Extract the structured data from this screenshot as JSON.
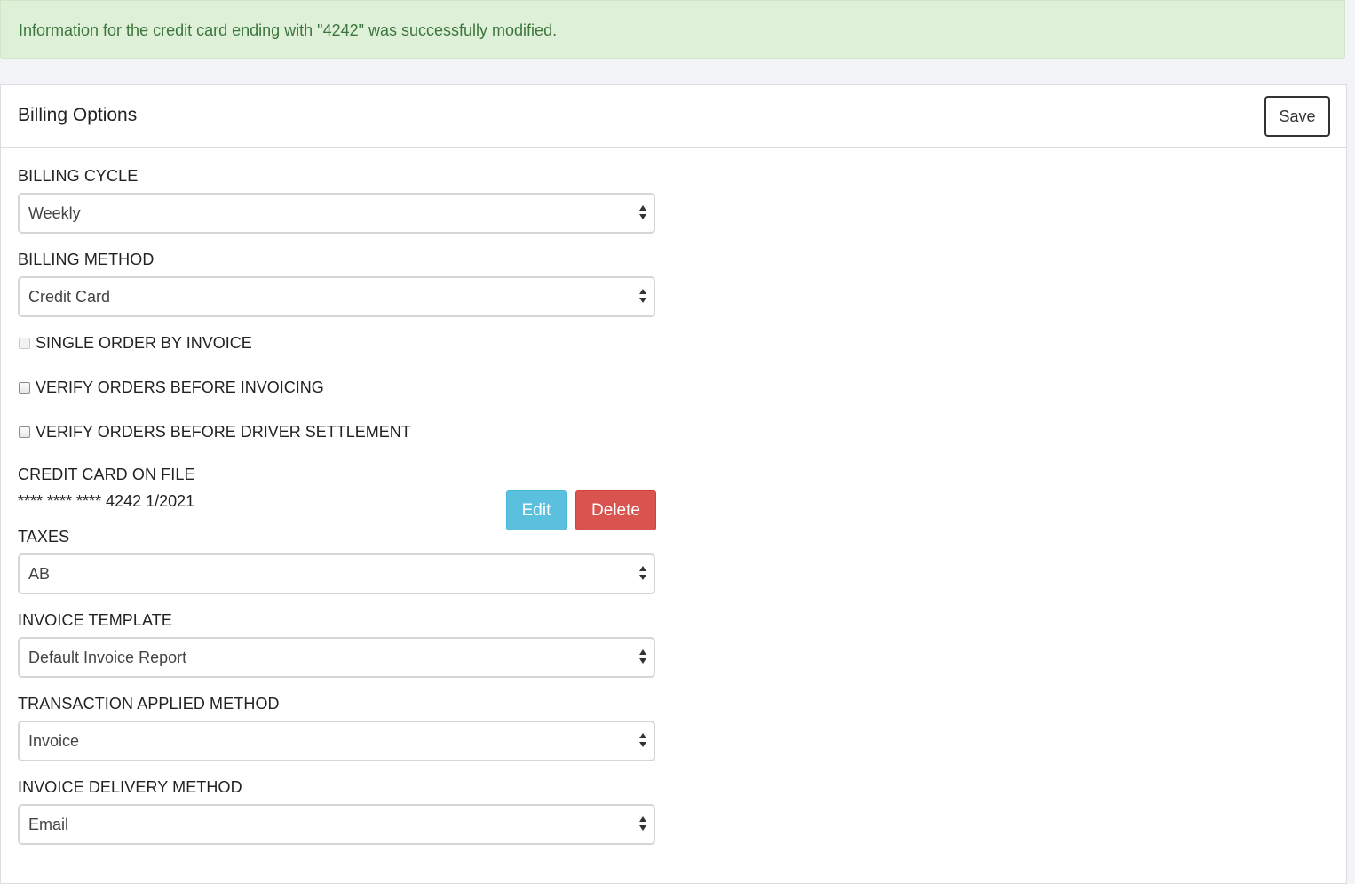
{
  "alert": {
    "message": "Information for the credit card ending with \"4242\" was successfully modified."
  },
  "panel": {
    "title": "Billing Options",
    "save_label": "Save"
  },
  "form": {
    "billing_cycle": {
      "label": "BILLING CYCLE",
      "value": "Weekly"
    },
    "billing_method": {
      "label": "BILLING METHOD",
      "value": "Credit Card"
    },
    "checkboxes": [
      {
        "label": "SINGLE ORDER BY INVOICE",
        "checked": false,
        "disabled": true
      },
      {
        "label": "VERIFY ORDERS BEFORE INVOICING",
        "checked": false,
        "disabled": false
      },
      {
        "label": "VERIFY ORDERS BEFORE DRIVER SETTLEMENT",
        "checked": false,
        "disabled": false
      }
    ],
    "credit_card": {
      "label": "CREDIT CARD ON FILE",
      "value": "**** **** **** 4242 1/2021",
      "edit_label": "Edit",
      "delete_label": "Delete"
    },
    "taxes": {
      "label": "TAXES",
      "value": "AB"
    },
    "invoice_template": {
      "label": "INVOICE TEMPLATE",
      "value": "Default Invoice Report"
    },
    "transaction_applied_method": {
      "label": "TRANSACTION APPLIED METHOD",
      "value": "Invoice"
    },
    "invoice_delivery_method": {
      "label": "INVOICE DELIVERY METHOD",
      "value": "Email"
    }
  },
  "colors": {
    "alert_bg": "#dff0d8",
    "alert_text": "#3c763d",
    "edit_button": "#5bc0de",
    "delete_button": "#d9534f"
  }
}
